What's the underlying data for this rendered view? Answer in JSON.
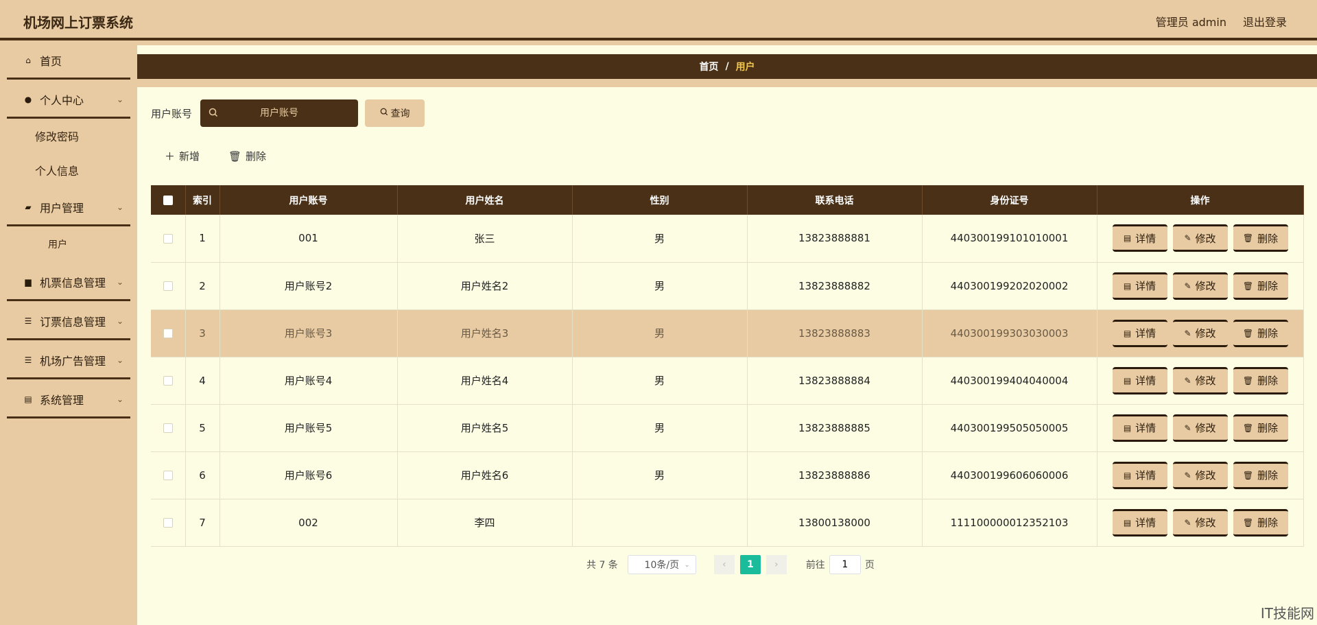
{
  "app": {
    "title": "机场网上订票系统",
    "user_label": "管理员 admin",
    "logout": "退出登录"
  },
  "sidebar": {
    "home": "首页",
    "personal_center": "个人中心",
    "change_password": "修改密码",
    "personal_info": "个人信息",
    "user_management": "用户管理",
    "user": "用户",
    "ticket_info_management": "机票信息管理",
    "booking_info_management": "订票信息管理",
    "ad_management": "机场广告管理",
    "system_management": "系统管理"
  },
  "breadcrumb": {
    "home": "首页",
    "sep": "/",
    "current": "用户"
  },
  "search": {
    "label": "用户账号",
    "placeholder": "用户账号",
    "button": "查询"
  },
  "actions": {
    "add": "新增",
    "delete": "删除"
  },
  "table": {
    "headers": [
      "",
      "索引",
      "用户账号",
      "用户姓名",
      "性别",
      "联系电话",
      "身份证号",
      "操作"
    ],
    "rows": [
      [
        "1",
        "001",
        "张三",
        "男",
        "13823888881",
        "440300199101010001"
      ],
      [
        "2",
        "用户账号2",
        "用户姓名2",
        "男",
        "13823888882",
        "440300199202020002"
      ],
      [
        "3",
        "用户账号3",
        "用户姓名3",
        "男",
        "13823888883",
        "440300199303030003"
      ],
      [
        "4",
        "用户账号4",
        "用户姓名4",
        "男",
        "13823888884",
        "440300199404040004"
      ],
      [
        "5",
        "用户账号5",
        "用户姓名5",
        "男",
        "13823888885",
        "440300199505050005"
      ],
      [
        "6",
        "用户账号6",
        "用户姓名6",
        "男",
        "13823888886",
        "440300199606060006"
      ],
      [
        "7",
        "002",
        "李四",
        "",
        "13800138000",
        "111100000012352103"
      ]
    ],
    "op_labels": {
      "detail": "详情",
      "edit": "修改",
      "delete": "删除"
    }
  },
  "pagination": {
    "total": "共 7 条",
    "page_size": "10条/页",
    "current": "1",
    "goto": "前往",
    "goto_value": "1",
    "page_unit": "页"
  },
  "watermark": "IT技能网",
  "colors": {
    "accent": "#4a3016",
    "tan": "#e8cba2",
    "background": "#fdfde4",
    "page_active": "#1abc9c"
  },
  "icons": [
    "home-icon",
    "user-icon",
    "briefcase-icon",
    "ticket-icon",
    "list-icon",
    "clipboard-icon",
    "search-icon",
    "plus-icon",
    "trash-icon",
    "document-icon",
    "pencil-icon",
    "chevron-down-icon"
  ]
}
